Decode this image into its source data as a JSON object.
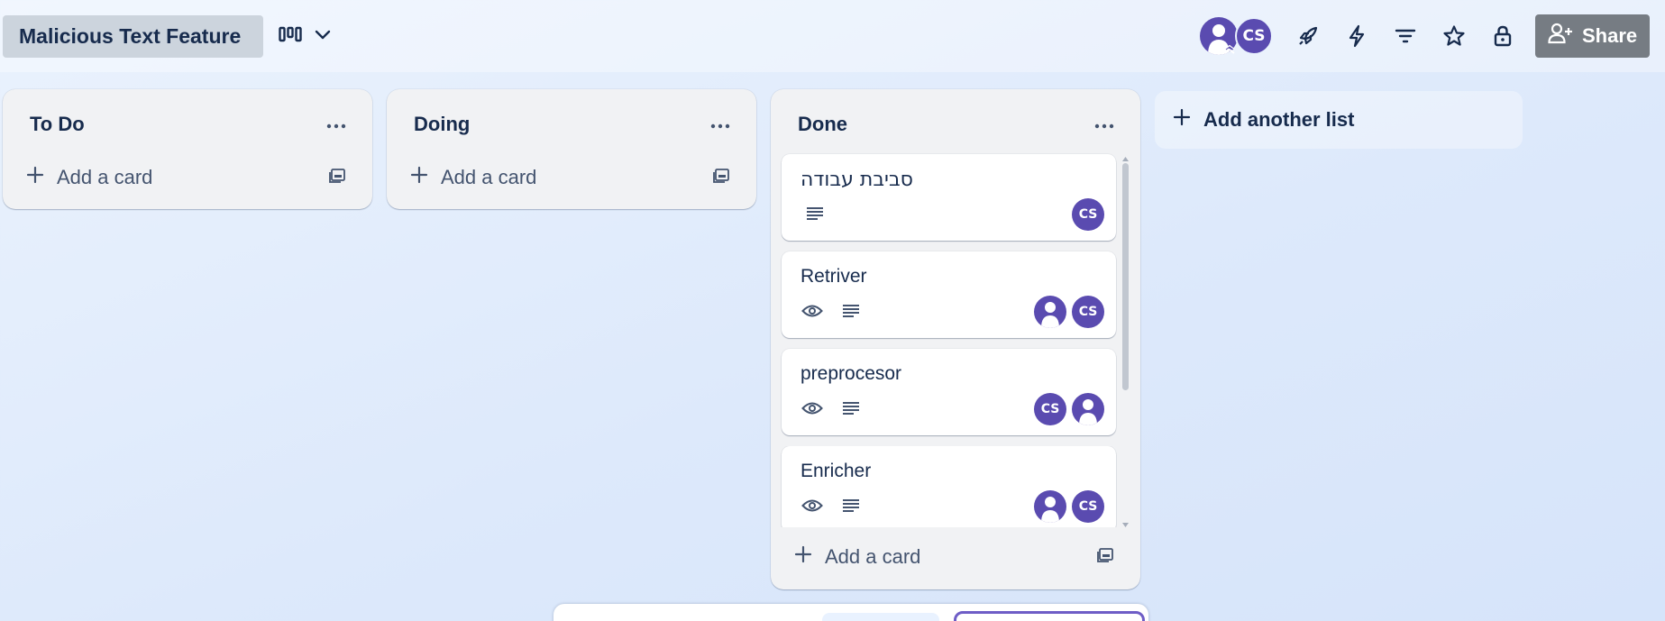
{
  "header": {
    "board_title": "Malicious Text Feature",
    "view_icon": "board-view-icon",
    "members": [
      {
        "type": "person",
        "label": ""
      },
      {
        "type": "initials",
        "label": "CS"
      }
    ],
    "icons": [
      "power-ups-rocket-icon",
      "automation-bolt-icon",
      "filter-icon",
      "star-icon",
      "lock-icon"
    ],
    "share_label": "Share"
  },
  "lists": [
    {
      "title": "To Do",
      "add_card_label": "Add a card",
      "cards": []
    },
    {
      "title": "Doing",
      "add_card_label": "Add a card",
      "cards": []
    },
    {
      "title": "Done",
      "add_card_label": "Add a card",
      "cards": [
        {
          "title": "סביבת עבודה",
          "watching": false,
          "has_description": true,
          "members": [
            "CS"
          ]
        },
        {
          "title": "Retriver",
          "watching": true,
          "has_description": true,
          "members": [
            "person",
            "CS"
          ]
        },
        {
          "title": "preprocesor",
          "watching": true,
          "has_description": true,
          "members": [
            "CS",
            "person"
          ]
        },
        {
          "title": "Enricher",
          "watching": true,
          "has_description": true,
          "members": [
            "person",
            "CS"
          ]
        }
      ]
    }
  ],
  "add_list_label": "Add another list",
  "colors": {
    "avatar": "#5a4bb0",
    "share_button": "#767c83",
    "list_background": "#f1f2f4",
    "title_chip": "#ccd4dd"
  }
}
